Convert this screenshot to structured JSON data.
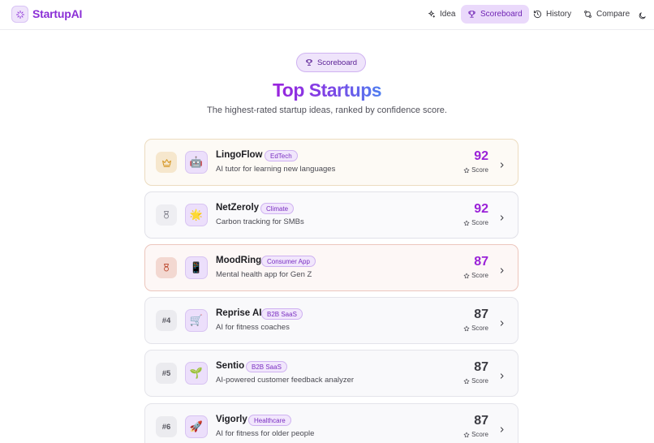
{
  "app": {
    "name": "StartupAI",
    "brand_color": "#8b2fd6"
  },
  "nav": [
    {
      "label": "Idea",
      "icon": "sparkles-icon",
      "active": false
    },
    {
      "label": "Scoreboard",
      "icon": "trophy-icon",
      "active": true
    },
    {
      "label": "History",
      "icon": "history-icon",
      "active": false
    },
    {
      "label": "Compare",
      "icon": "compare-icon",
      "active": false
    }
  ],
  "theme_toggle_icon": "moon-icon",
  "hero": {
    "badge": "Scoreboard",
    "title": "Top Startups",
    "subtitle": "The highest-rated startup ideas, ranked by confidence score."
  },
  "score_label": "Score",
  "startups": [
    {
      "rank": "",
      "medal": "crown-icon",
      "emoji": "🤖",
      "name": "LingoFlow",
      "tag": "EdTech",
      "description": "AI tutor for learning new languages",
      "score": "92"
    },
    {
      "rank": "",
      "medal": "medal-icon",
      "emoji": "🌟",
      "name": "NetZeroly",
      "tag": "Climate",
      "description": "Carbon tracking for SMBs",
      "score": "92"
    },
    {
      "rank": "",
      "medal": "medal-icon",
      "emoji": "📱",
      "name": "MoodRing",
      "tag": "Consumer App",
      "description": "Mental health app for Gen Z",
      "score": "87"
    },
    {
      "rank": "#4",
      "medal": "",
      "emoji": "🛒",
      "name": "Reprise AI",
      "tag": "B2B SaaS",
      "description": "AI for fitness coaches",
      "score": "87"
    },
    {
      "rank": "#5",
      "medal": "",
      "emoji": "🌱",
      "name": "Sentio",
      "tag": "B2B SaaS",
      "description": "AI-powered customer feedback analyzer",
      "score": "87"
    },
    {
      "rank": "#6",
      "medal": "",
      "emoji": "🚀",
      "name": "Vigorly",
      "tag": "Healthcare",
      "description": "AI for fitness for older people",
      "score": "87"
    }
  ]
}
